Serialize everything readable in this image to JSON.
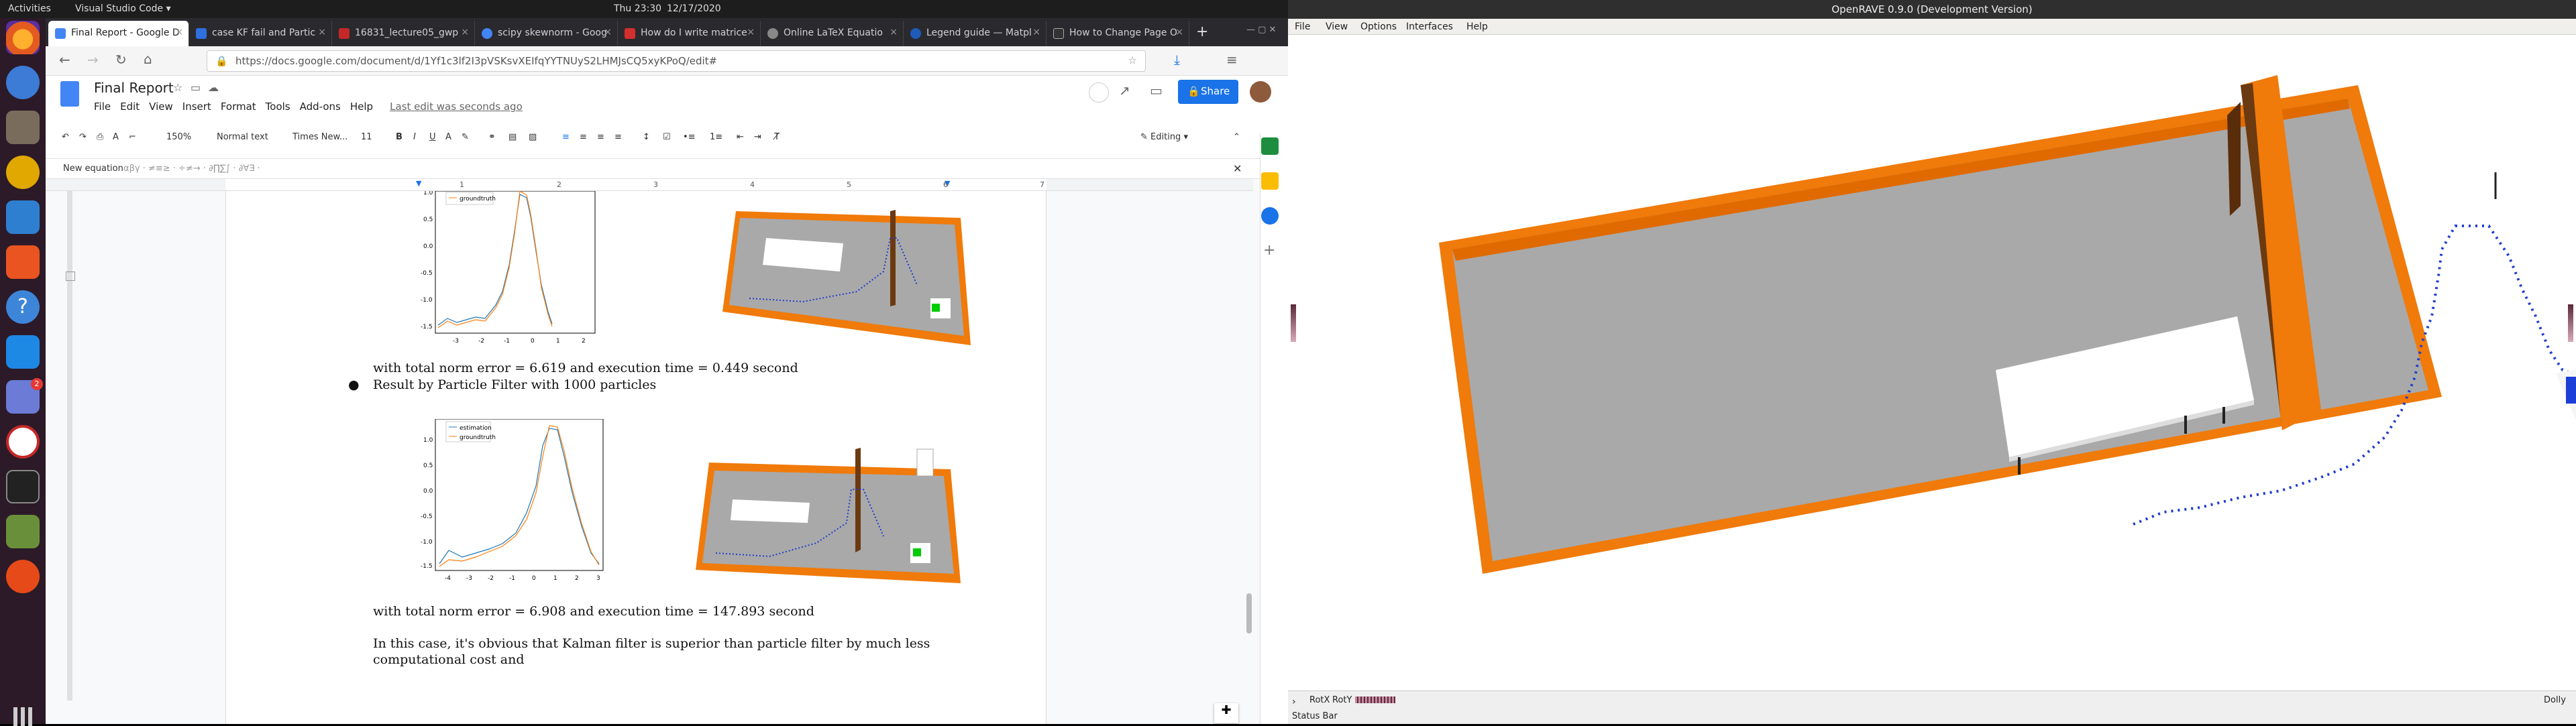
{
  "topbar": {
    "activities": "Activities",
    "app": "Visual Studio Code ▾",
    "clock": "Thu 23:30",
    "date": "12/17/2020"
  },
  "dock": {
    "badge": "2"
  },
  "browser": {
    "tabs": [
      {
        "label": "Final Report - Google D",
        "color": "#4285f4"
      },
      {
        "label": "case KF fail and Partic",
        "color": "#2f6fde"
      },
      {
        "label": "16831_lecture05_gwp",
        "color": "#c62828"
      },
      {
        "label": "scipy skewnorm - Goog",
        "color": "#4285f4"
      },
      {
        "label": "How do I write matrice",
        "color": "#d32f2f"
      },
      {
        "label": "Online LaTeX Equatio",
        "color": "#888888"
      },
      {
        "label": "Legend guide — Matpl",
        "color": "#1e5bb8"
      },
      {
        "label": "How to Change Page O",
        "color": "#333333"
      }
    ],
    "new_tab": "+",
    "url": "https://docs.google.com/document/d/1Yf1c3lf2I3pVSKsvXEIfqYYTNUyS2LHMJsCQ5xyKPoQ/edit#"
  },
  "gdocs": {
    "title": "Final Report",
    "menu": [
      "File",
      "Edit",
      "View",
      "Insert",
      "Format",
      "Tools",
      "Add-ons",
      "Help"
    ],
    "last_edit": "Last edit was seconds ago",
    "share": "Share",
    "zoom": "150%",
    "style": "Normal text",
    "font": "Times New...",
    "size": "11",
    "mode": "Editing",
    "eq_label": "New equation",
    "eq_tools": "αβγ ·  ≠≡≥ ·  ÷≠→ ·  ∂∏∑∫ ·  ∂∀∃ ·",
    "ruler": [
      "1",
      "2",
      "3",
      "4",
      "5",
      "6",
      "7"
    ],
    "text1": "with total norm error = 6.619 and execution time = 0.449 second",
    "bullet": "Result by Particle Filter with 1000 particles",
    "text2": "with total norm error = 6.908 and execution time = 147.893 second",
    "text3": "In this case, it's obvious that Kalman filter is superior than particle filter by much less",
    "text4": "computational cost and",
    "plot1_legend": [
      "groundtruth"
    ],
    "plot2_legend": [
      "estimation",
      "groundtruth"
    ],
    "plot1_yticks": [
      "1.0",
      "0.5",
      "0.0",
      "-0.5",
      "-1.0",
      "-1.5"
    ],
    "plot1_xticks": [
      "-3",
      "-2",
      "-1",
      "0",
      "1",
      "2"
    ],
    "plot2_yticks": [
      "1.0",
      "0.5",
      "0.0",
      "-0.5",
      "-1.0",
      "-1.5"
    ],
    "plot2_xticks": [
      "-4",
      "-3",
      "-2",
      "-1",
      "0",
      "1",
      "2",
      "3"
    ]
  },
  "openrave": {
    "title": "OpenRAVE 0.9.0 (Development Version)",
    "menu": [
      "File",
      "View",
      "Options",
      "Interfaces",
      "Help"
    ],
    "rotx": "RotX",
    "roty": "RotY",
    "dolly": "Dolly",
    "status": "Status Bar"
  },
  "colors": {
    "orange": "#ff7f0e",
    "blue": "#1f77b4",
    "wall": "#f07a0a",
    "floor": "#a9a9a9"
  }
}
